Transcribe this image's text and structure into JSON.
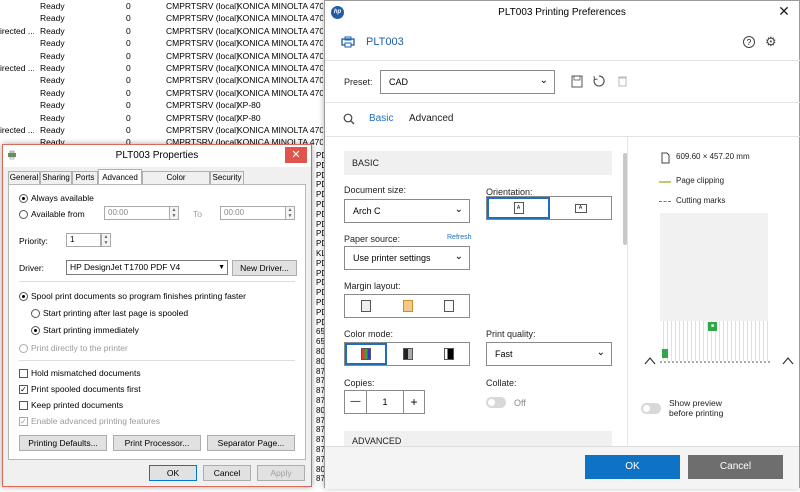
{
  "bg_list": {
    "rows": [
      {
        "dir": "",
        "status": "Ready",
        "jobs": "0",
        "server": "CMPRTSRV (local)",
        "driver": "KONICA MINOLTA 4700P"
      },
      {
        "dir": "",
        "status": "Ready",
        "jobs": "0",
        "server": "CMPRTSRV (local)",
        "driver": "KONICA MINOLTA 4700P"
      },
      {
        "dir": "irected ...",
        "status": "Ready",
        "jobs": "0",
        "server": "CMPRTSRV (local)",
        "driver": "KONICA MINOLTA 4700P"
      },
      {
        "dir": "",
        "status": "Ready",
        "jobs": "0",
        "server": "CMPRTSRV (local)",
        "driver": "KONICA MINOLTA 4700P"
      },
      {
        "dir": "",
        "status": "Ready",
        "jobs": "0",
        "server": "CMPRTSRV (local)",
        "driver": "KONICA MINOLTA 4700P"
      },
      {
        "dir": "irected ...",
        "status": "Ready",
        "jobs": "0",
        "server": "CMPRTSRV (local)",
        "driver": "KONICA MINOLTA 4700P"
      },
      {
        "dir": "",
        "status": "Ready",
        "jobs": "0",
        "server": "CMPRTSRV (local)",
        "driver": "KONICA MINOLTA 4700P"
      },
      {
        "dir": "",
        "status": "Ready",
        "jobs": "0",
        "server": "CMPRTSRV (local)",
        "driver": "KONICA MINOLTA 4700P"
      },
      {
        "dir": "",
        "status": "Ready",
        "jobs": "0",
        "server": "CMPRTSRV (local)",
        "driver": "XP-80"
      },
      {
        "dir": "",
        "status": "Ready",
        "jobs": "0",
        "server": "CMPRTSRV (local)",
        "driver": "XP-80"
      },
      {
        "dir": "irected ...",
        "status": "Ready",
        "jobs": "0",
        "server": "CMPRTSRV (local)",
        "driver": "KONICA MINOLTA 4700P"
      },
      {
        "dir": "",
        "status": "Ready",
        "jobs": "0",
        "server": "CMPRTSRV (local)",
        "driver": "KONICA MINOLTA 4700P"
      }
    ],
    "fragments": [
      "PD",
      "PD",
      "PD",
      "PD",
      "PD",
      "PD",
      "PD",
      "PD",
      "PD",
      "PD",
      "KL",
      "PD",
      "PD",
      "PD",
      "PD",
      "PD",
      "PD",
      "PD",
      "65",
      "65",
      "80",
      "80",
      "87",
      "87",
      "87",
      "87",
      "80",
      "87",
      "87",
      "87",
      "87",
      "87",
      "80",
      "87"
    ]
  },
  "props": {
    "title": "PLT003 Properties",
    "close": "✕",
    "tabs": [
      "General",
      "Sharing",
      "Ports",
      "Advanced",
      "Color Management",
      "Security"
    ],
    "always_available": "Always available",
    "available_from": "Available from",
    "time_from": "00:00",
    "time_to_label": "To",
    "time_to": "00:00",
    "priority_label": "Priority:",
    "priority_value": "1",
    "driver_label": "Driver:",
    "driver_value": "HP DesignJet T1700 PDF V4",
    "new_driver": "New Driver...",
    "spool": "Spool print documents so program finishes printing faster",
    "start_after": "Start printing after last page is spooled",
    "start_immediately": "Start printing immediately",
    "print_directly": "Print directly to the printer",
    "hold_mismatched": "Hold mismatched documents",
    "print_spooled_first": "Print spooled documents first",
    "keep_printed": "Keep printed documents",
    "enable_advanced": "Enable advanced printing features",
    "printing_defaults": "Printing Defaults...",
    "print_processor": "Print Processor...",
    "separator_page": "Separator Page...",
    "ok": "OK",
    "cancel": "Cancel",
    "apply": "Apply"
  },
  "hp": {
    "window_title": "PLT003 Printing Preferences",
    "logo": "hp",
    "close": "✕",
    "printer_name": "PLT003",
    "help": "?",
    "preset_label": "Preset:",
    "preset_value": "CAD",
    "tab_basic": "Basic",
    "tab_advanced": "Advanced",
    "section_basic": "BASIC",
    "document_size_label": "Document size:",
    "document_size_value": "Arch C",
    "orientation_label": "Orientation:",
    "paper_source_label": "Paper source:",
    "refresh": "Refresh",
    "paper_source_value": "Use printer settings",
    "margin_layout_label": "Margin layout:",
    "color_mode_label": "Color mode:",
    "print_quality_label": "Print quality:",
    "print_quality_value": "Fast",
    "copies_label": "Copies:",
    "copies_value": "1",
    "copies_minus": "—",
    "copies_plus": "+",
    "collate_label": "Collate:",
    "collate_state": "Off",
    "section_advanced": "ADVANCED",
    "page_size": "609.60 × 457.20 mm",
    "page_clipping": "Page clipping",
    "cutting_marks": "Cutting marks",
    "show_preview": "Show preview before printing",
    "ok": "OK",
    "cancel": "Cancel",
    "accent": "#1e6ebd"
  }
}
